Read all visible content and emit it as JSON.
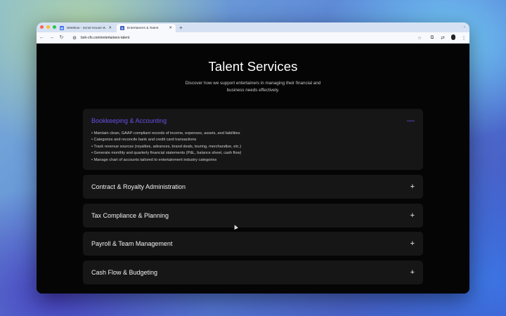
{
  "browser": {
    "tabs": [
      {
        "label": "Webflow - Scroll House Wes...",
        "favicon": "W",
        "favicon_color": "#3a6ff0",
        "active": false
      },
      {
        "label": "Entertainers & Talent",
        "favicon": "S",
        "favicon_color": "#3b5bc4",
        "active": true
      }
    ],
    "new_tab": "+",
    "url": "boh-cfo.com/entertainers-talent"
  },
  "page": {
    "title": "Talent Services",
    "subtitle": "Discover how we support entertainers in managing their financial and business needs effectively.",
    "accent_color": "#6b4fe6",
    "sections": [
      {
        "title": "Bookkeeping & Accounting",
        "expanded": true,
        "toggle": "—",
        "items": [
          "Maintain clean, GAAP-compliant records of income, expenses, assets, and liabilities",
          "Categorize and reconcile bank and credit card transactions",
          "Track revenue sources (royalties, advances, brand deals, touring, merchandise, etc.)",
          "Generate monthly and quarterly financial statements (P&L, balance sheet, cash flow)",
          "Manage chart of accounts tailored to entertainment industry categories"
        ]
      },
      {
        "title": "Contract & Royalty Administration",
        "expanded": false,
        "toggle": "+"
      },
      {
        "title": "Tax Compliance & Planning",
        "expanded": false,
        "toggle": "+"
      },
      {
        "title": "Payroll & Team Management",
        "expanded": false,
        "toggle": "+"
      },
      {
        "title": "Cash Flow & Budgeting",
        "expanded": false,
        "toggle": "+"
      }
    ]
  }
}
